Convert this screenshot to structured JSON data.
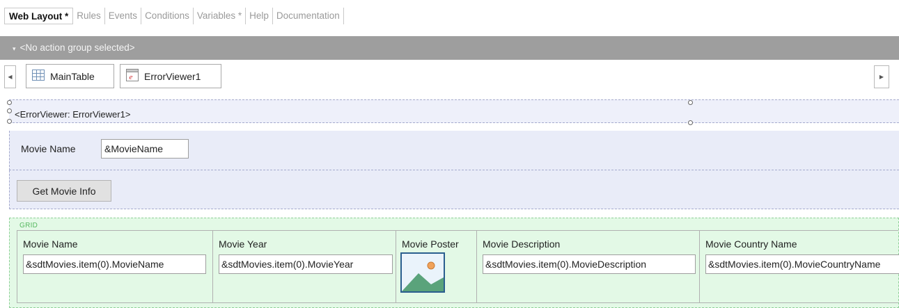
{
  "tabs": [
    {
      "label": "Web Layout *",
      "active": true
    },
    {
      "label": "Rules",
      "active": false
    },
    {
      "label": "Events",
      "active": false
    },
    {
      "label": "Conditions",
      "active": false
    },
    {
      "label": "Variables *",
      "active": false
    },
    {
      "label": "Help",
      "active": false
    },
    {
      "label": "Documentation",
      "active": false
    }
  ],
  "action_group": {
    "label": "<No action group selected>"
  },
  "breadcrumb": [
    {
      "label": "MainTable",
      "icon": "table-icon"
    },
    {
      "label": "ErrorViewer1",
      "icon": "error-viewer-icon"
    }
  ],
  "form": {
    "error_viewer_label": "<ErrorViewer: ErrorViewer1>",
    "movie_name_label": "Movie Name",
    "movie_name_value": "&MovieName",
    "get_info_button": "Get Movie Info"
  },
  "grid": {
    "label": "GRID",
    "columns": [
      {
        "header": "Movie Name",
        "value": "&sdtMovies.item(0).MovieName"
      },
      {
        "header": "Movie Year",
        "value": "&sdtMovies.item(0).MovieYear"
      },
      {
        "header": "Movie Poster",
        "value": "",
        "icon": "image-placeholder-icon"
      },
      {
        "header": "Movie Description",
        "value": "&sdtMovies.item(0).MovieDescription"
      },
      {
        "header": "Movie Country Name",
        "value": "&sdtMovies.item(0).MovieCountryName"
      }
    ]
  },
  "colors": {
    "action_bar": "#9e9e9e",
    "form_background": "#e9ecf8",
    "grid_background": "#e3f9e6",
    "grid_label": "#55b85f"
  }
}
